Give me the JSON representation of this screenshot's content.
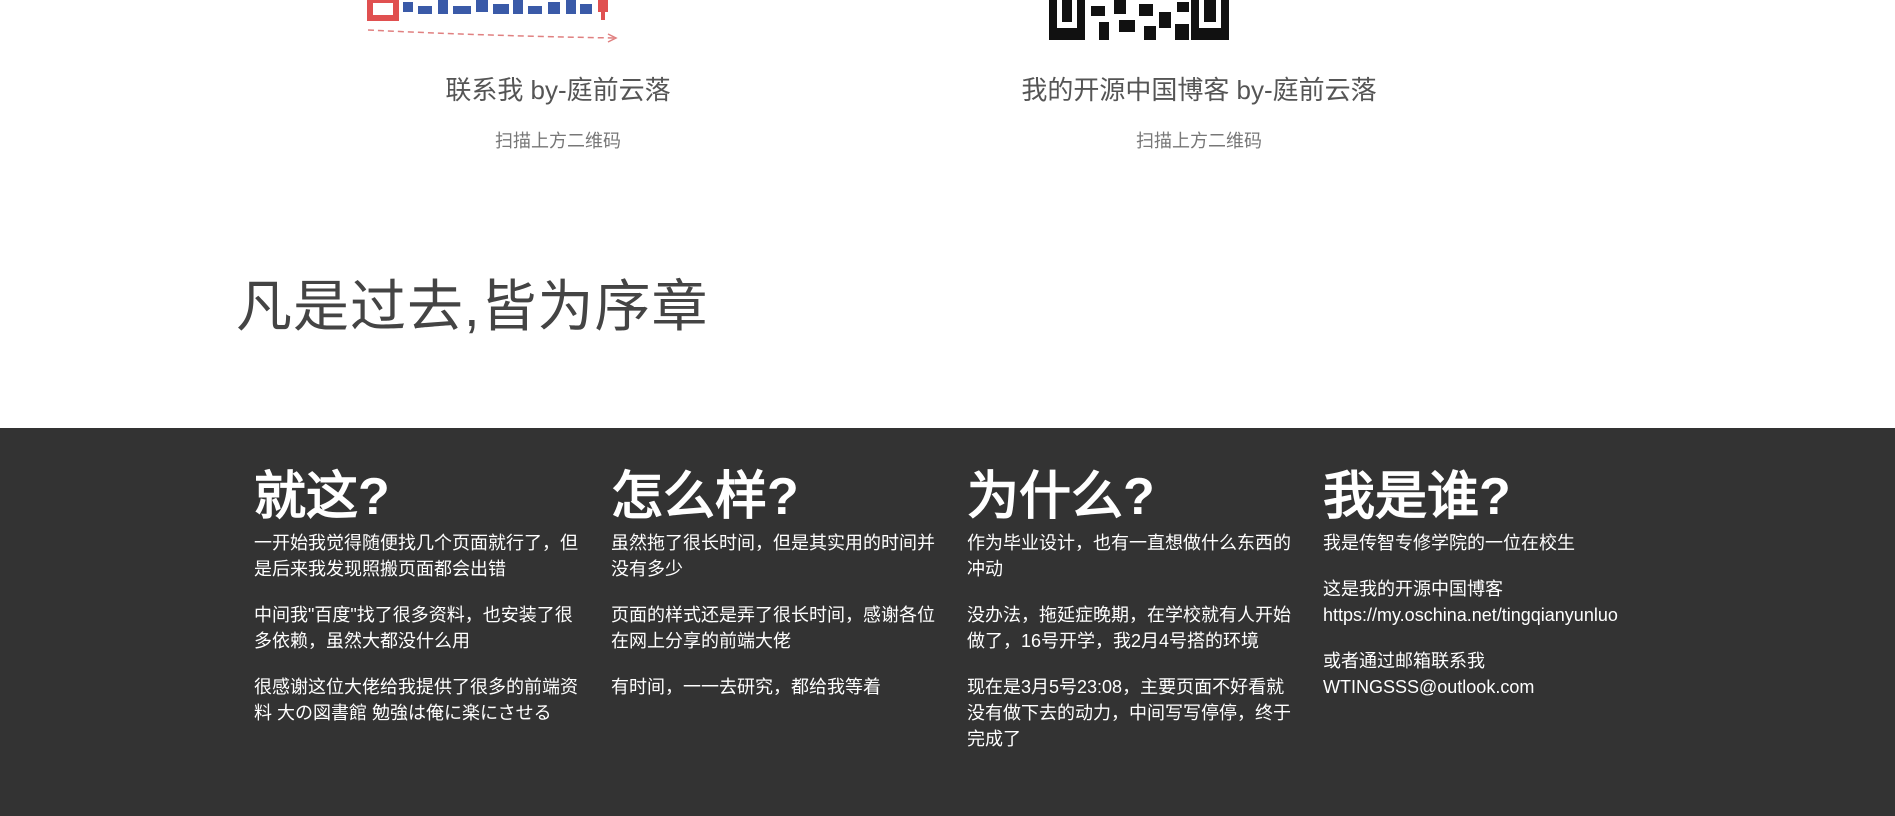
{
  "qr_cards": [
    {
      "title": "联系我 by-庭前云落",
      "subtitle": "扫描上方二维码"
    },
    {
      "title": "我的开源中国博客 by-庭前云落",
      "subtitle": "扫描上方二维码"
    }
  ],
  "motto": "凡是过去,皆为序章",
  "footer": {
    "columns": [
      {
        "heading": "就这?",
        "paragraphs": [
          "一开始我觉得随便找几个页面就行了，但是后来我发现照搬页面都会出错",
          "中间我\"百度\"找了很多资料，也安装了很多依赖，虽然大都没什么用",
          "很感谢这位大佬给我提供了很多的前端资料 大の図書館 勉強は俺に楽にさせる"
        ]
      },
      {
        "heading": "怎么样?",
        "paragraphs": [
          "虽然拖了很长时间，但是其实用的时间并没有多少",
          "页面的样式还是弄了很长时间，感谢各位在网上分享的前端大佬",
          "有时间，一一去研究，都给我等着"
        ]
      },
      {
        "heading": "为什么?",
        "paragraphs": [
          "作为毕业设计，也有一直想做什么东西的冲动",
          "没办法，拖延症晚期，在学校就有人开始做了，16号开学，我2月4号搭的环境",
          "现在是3月5号23:08，主要页面不好看就没有做下去的动力，中间写写停停，终于完成了"
        ]
      },
      {
        "heading": "我是谁?",
        "paragraphs": [
          "我是传智专修学院的一位在校生",
          "这是我的开源中国博客 https://my.oschina.net/tingqianyunluo",
          "或者通过邮箱联系我 WTINGSSS@outlook.com"
        ]
      }
    ]
  }
}
